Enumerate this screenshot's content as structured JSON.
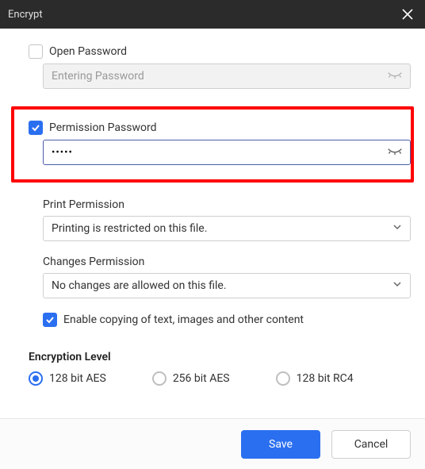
{
  "titlebar": {
    "title": "Encrypt"
  },
  "open_password": {
    "label": "Open Password",
    "checked": false,
    "placeholder": "Entering Password",
    "value": ""
  },
  "permission_password": {
    "label": "Permission Password",
    "checked": true,
    "value": "•••••"
  },
  "print_permission": {
    "label": "Print Permission",
    "value": "Printing is restricted on this file."
  },
  "changes_permission": {
    "label": "Changes Permission",
    "value": "No changes are allowed on this file."
  },
  "enable_copying": {
    "label": "Enable copying of text, images and other content",
    "checked": true
  },
  "encryption": {
    "title": "Encryption Level",
    "options": [
      {
        "label": "128 bit AES",
        "selected": true
      },
      {
        "label": "256 bit AES",
        "selected": false
      },
      {
        "label": "128 bit RC4",
        "selected": false
      }
    ]
  },
  "buttons": {
    "save": "Save",
    "cancel": "Cancel"
  }
}
